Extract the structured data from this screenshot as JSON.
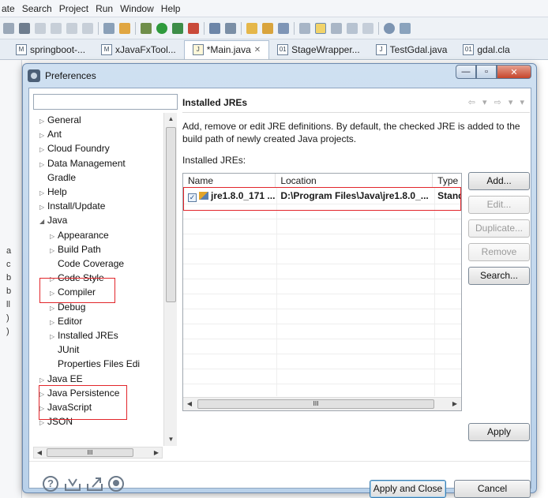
{
  "menubar": {
    "items": [
      "ate",
      "Search",
      "Project",
      "Run",
      "Window",
      "Help"
    ]
  },
  "editor_tabs": [
    {
      "label": "springboot-...",
      "icon": "maven-file-icon"
    },
    {
      "label": "xJavaFxTool...",
      "icon": "maven-file-icon"
    },
    {
      "label": "*Main.java",
      "icon": "java-file-icon",
      "active": true,
      "close": "✕"
    },
    {
      "label": "StageWrapper...",
      "icon": "class-file-icon"
    },
    {
      "label": "TestGdal.java",
      "icon": "java-file-icon"
    },
    {
      "label": "gdal.cla",
      "icon": "class-file-icon"
    }
  ],
  "left_gutter": [
    "a",
    "c",
    "b",
    "b",
    "ll",
    ")",
    ")"
  ],
  "dialog": {
    "title": "Preferences",
    "window_buttons": {
      "minimize": "—",
      "maximize": "▫",
      "close": "✕"
    },
    "filter": {
      "placeholder": "",
      "value": ""
    },
    "tree": [
      {
        "label": "General",
        "indent": 0,
        "twistie": "▷"
      },
      {
        "label": "Ant",
        "indent": 0,
        "twistie": "▷"
      },
      {
        "label": "Cloud Foundry",
        "indent": 0,
        "twistie": "▷"
      },
      {
        "label": "Data Management",
        "indent": 0,
        "twistie": "▷"
      },
      {
        "label": "Gradle",
        "indent": 0,
        "twistie": ""
      },
      {
        "label": "Help",
        "indent": 0,
        "twistie": "▷"
      },
      {
        "label": "Install/Update",
        "indent": 0,
        "twistie": "▷"
      },
      {
        "label": "Java",
        "indent": 0,
        "twistie": "◢"
      },
      {
        "label": "Appearance",
        "indent": 1,
        "twistie": "▷"
      },
      {
        "label": "Build Path",
        "indent": 1,
        "twistie": "▷"
      },
      {
        "label": "Code Coverage",
        "indent": 1,
        "twistie": ""
      },
      {
        "label": "Code Style",
        "indent": 1,
        "twistie": "▷"
      },
      {
        "label": "Compiler",
        "indent": 1,
        "twistie": "▷"
      },
      {
        "label": "Debug",
        "indent": 1,
        "twistie": "▷"
      },
      {
        "label": "Editor",
        "indent": 1,
        "twistie": "▷"
      },
      {
        "label": "Installed JREs",
        "indent": 1,
        "twistie": "▷",
        "selected": true
      },
      {
        "label": "JUnit",
        "indent": 1,
        "twistie": ""
      },
      {
        "label": "Properties Files Edi",
        "indent": 1,
        "twistie": ""
      },
      {
        "label": "Java EE",
        "indent": 0,
        "twistie": "▷"
      },
      {
        "label": "Java Persistence",
        "indent": 0,
        "twistie": "▷"
      },
      {
        "label": "JavaScript",
        "indent": 0,
        "twistie": "▷"
      },
      {
        "label": "JSON",
        "indent": 0,
        "twistie": "▷"
      }
    ],
    "page": {
      "title": "Installed JREs",
      "nav": "⇦ ▾ ⇨ ▾ ▾",
      "description": "Add, remove or edit JRE definitions. By default, the checked JRE is added to the build path of newly created Java projects.",
      "list_label": "Installed JREs:",
      "columns": [
        "Name",
        "Location",
        "Type"
      ],
      "rows": [
        {
          "checked": true,
          "name": "jre1.8.0_171 ...",
          "location": "D:\\Program Files\\Java\\jre1.8.0_...",
          "type": "Stand"
        }
      ],
      "scroll_marker": "III",
      "buttons": {
        "add": "Add...",
        "edit": "Edit...",
        "duplicate": "Duplicate...",
        "remove": "Remove",
        "search": "Search...",
        "apply": "Apply"
      }
    },
    "footer": {
      "apply_and_close": "Apply and Close",
      "cancel": "Cancel",
      "help_glyph": "?"
    }
  },
  "colors": {
    "highlight_box": "#e2262b",
    "dialog_frame": "#b9d1ea"
  }
}
